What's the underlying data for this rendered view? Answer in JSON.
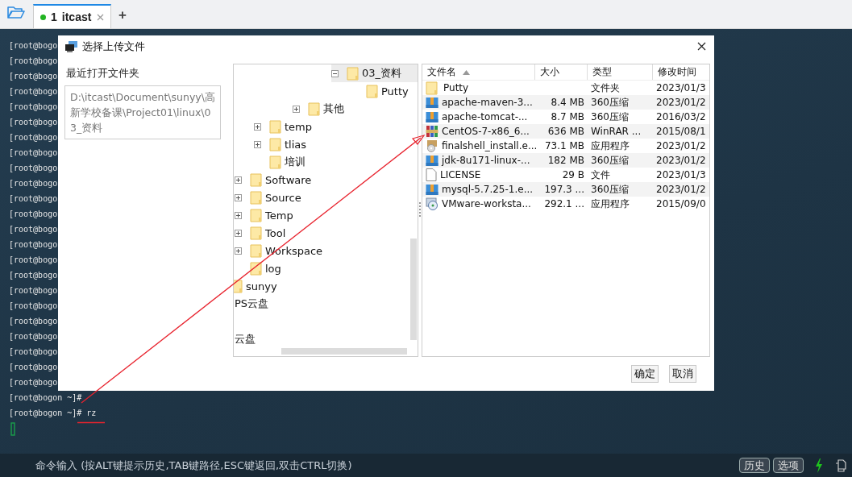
{
  "tabbar": {
    "tabs": [
      {
        "number": "1",
        "label": "itcast",
        "selected": true,
        "connected": true
      }
    ],
    "add": "+"
  },
  "terminal": {
    "lines": [
      "[root@bogo",
      "[root@bogo",
      "[root@bogo",
      "[root@bogo",
      "[root@bogo",
      "[root@bogo",
      "[root@bogo",
      "[root@bogo",
      "[root@bogo",
      "[root@bogo",
      "[root@bogo",
      "[root@bogo",
      "[root@bogo",
      "[root@bogo",
      "[root@bogo",
      "[root@bogo",
      "[root@bogo",
      "[root@bogo",
      "[root@bogo",
      "[root@bogo",
      "[root@bogo",
      "[root@bogo",
      "[root@bogo",
      "[root@bogon ~]#",
      "[root@bogon ~]# rz"
    ]
  },
  "dialog": {
    "title": "选择上传文件",
    "recent_label": "最近打开文件夹",
    "recent_path": "D:\\itcast\\Document\\sunyy\\高新学校备课\\Project01\\linux\\03_资料",
    "tree": [
      {
        "kind": "group",
        "children": [
          {
            "kind": "group",
            "children": [
              {
                "kind": "group",
                "children": [
                  {
                    "kind": "group",
                    "children": [
                      {
                        "kind": "group",
                        "children": [
                          {
                            "kind": "group",
                            "children": [
                              {
                                "kind": "group",
                                "children": [
                                  {
                                    "kind": "folder",
                                    "label": "03_资料",
                                    "expanded": true,
                                    "selected": true,
                                    "children": [
                                      {
                                        "kind": "folder",
                                        "label": "Putty",
                                        "selected": false
                                      }
                                    ]
                                  }
                                ]
                              }
                            ]
                          },
                          {
                            "kind": "folder",
                            "label": "其他",
                            "expanded": false,
                            "selected": false
                          }
                        ]
                      }
                    ]
                  },
                  {
                    "kind": "folder",
                    "label": "temp",
                    "expanded": false,
                    "selected": false
                  },
                  {
                    "kind": "folder",
                    "label": "tlias",
                    "expanded": false,
                    "selected": false
                  },
                  {
                    "kind": "folder",
                    "label": "培训",
                    "selected": false
                  }
                ]
              },
              {
                "kind": "folder",
                "label": "Software",
                "expanded": false,
                "selected": false
              },
              {
                "kind": "folder",
                "label": "Source",
                "expanded": false,
                "selected": false
              },
              {
                "kind": "folder",
                "label": "Temp",
                "expanded": false,
                "selected": false
              },
              {
                "kind": "folder",
                "label": "Tool",
                "expanded": false,
                "selected": false
              },
              {
                "kind": "folder",
                "label": "Workspace",
                "expanded": false,
                "selected": false
              },
              {
                "kind": "folder",
                "label": "log",
                "selected": false
              }
            ]
          },
          {
            "kind": "folder",
            "label": "sunyy",
            "selected": false
          }
        ]
      },
      {
        "kind": "drive",
        "label": "PS云盘",
        "selected": false
      },
      {
        "kind": "blank"
      },
      {
        "kind": "drive",
        "label": "云盘",
        "selected": false
      }
    ],
    "columns": [
      "文件名",
      "大小",
      "类型",
      "修改时间"
    ],
    "files": [
      {
        "kind": "folder",
        "name": "Putty",
        "type": "文件夹",
        "modified": "2023/01/3"
      },
      {
        "kind": "archive",
        "name": "apache-maven-3...",
        "size": "8.4 MB",
        "type": "360压缩",
        "modified": "2023/01/2"
      },
      {
        "kind": "archive",
        "name": "apache-tomcat-...",
        "size": "8.7 MB",
        "type": "360压缩",
        "modified": "2016/03/2"
      },
      {
        "kind": "rar",
        "name": "CentOS-7-x86_6...",
        "size": "636 MB",
        "type": "WinRAR ...",
        "modified": "2015/08/1"
      },
      {
        "kind": "installer",
        "name": "finalshell_install.e...",
        "size": "73.1 MB",
        "type": "应用程序",
        "modified": "2023/01/2"
      },
      {
        "kind": "archive",
        "name": "jdk-8u171-linux-...",
        "size": "182 MB",
        "type": "360压缩",
        "modified": "2023/01/2"
      },
      {
        "kind": "file",
        "name": "LICENSE",
        "size": "29 B",
        "type": "文件",
        "modified": "2023/01/3"
      },
      {
        "kind": "archive",
        "name": "mysql-5.7.25-1.e...",
        "size": "197.3 ...",
        "type": "360压缩",
        "modified": "2023/01/2"
      },
      {
        "kind": "vmware",
        "name": "VMware-worksta...",
        "size": "292.1 ...",
        "type": "应用程序",
        "modified": "2015/09/0"
      }
    ],
    "buttons": [
      "确定",
      "取消"
    ]
  },
  "command_bar": {
    "hint": "命令输入 (按ALT键提示历史,TAB键路径,ESC键返回,双击CTRL切换)",
    "buttons": [
      "历史",
      "选项"
    ]
  }
}
